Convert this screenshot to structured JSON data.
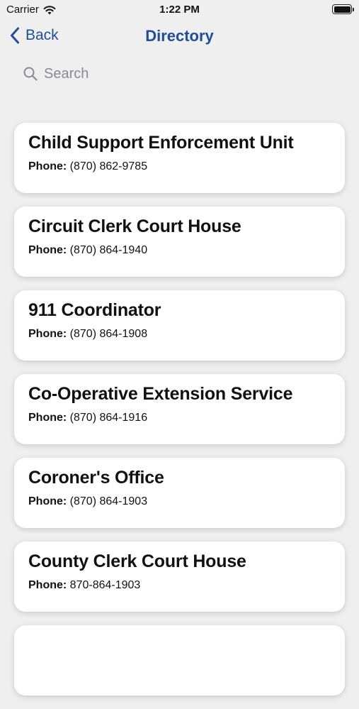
{
  "status_bar": {
    "carrier": "Carrier",
    "time": "1:22 PM"
  },
  "nav": {
    "back_label": "Back",
    "title": "Directory",
    "accent_color": "#1f4e96"
  },
  "search": {
    "placeholder": "Search",
    "value": ""
  },
  "phone_label": "Phone:",
  "entries": [
    {
      "name": "Child Support Enforcement Unit",
      "phone": "(870) 862-9785"
    },
    {
      "name": "Circuit Clerk Court House",
      "phone": "(870) 864-1940"
    },
    {
      "name": "911 Coordinator",
      "phone": "(870) 864-1908"
    },
    {
      "name": "Co-Operative Extension Service",
      "phone": "(870) 864-1916"
    },
    {
      "name": "Coroner's Office",
      "phone": "(870) 864-1903"
    },
    {
      "name": "County Clerk Court House",
      "phone": "870-864-1903"
    }
  ],
  "icons": {
    "wifi": "wifi-icon",
    "battery": "battery-icon",
    "back": "chevron-left-icon",
    "search": "search-icon"
  }
}
